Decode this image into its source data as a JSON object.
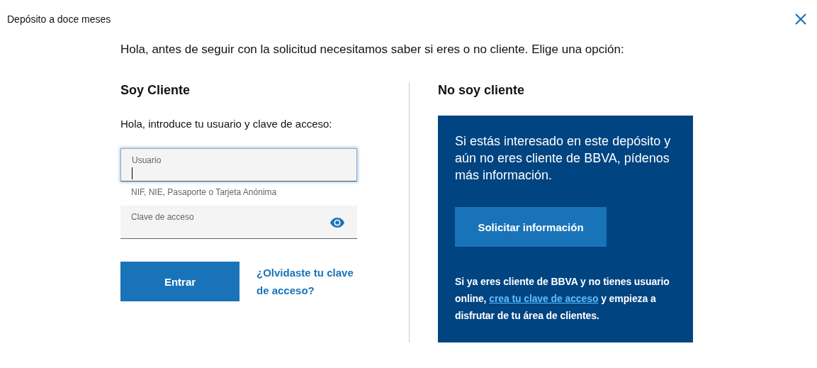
{
  "window": {
    "title": "Depósito a doce meses"
  },
  "intro": "Hola, antes de seguir con la solicitud necesitamos saber si eres o no cliente. Elige una opción:",
  "client": {
    "heading": "Soy Cliente",
    "prompt": "Hola, introduce tu usuario y clave de acceso:",
    "fields": [
      {
        "kind": "text",
        "placeholder": "Usuario",
        "focused": true,
        "hint": "NIF, NIE, Pasaporte o Tarjeta Anónima"
      },
      {
        "kind": "password",
        "placeholder": "Clave de acceso",
        "focused": false
      }
    ],
    "submit": "Entrar",
    "forgot_link": "¿Olvidaste tu clave de acceso?"
  },
  "non_client": {
    "heading": "No soy cliente",
    "message": "Si estás interesado en este depósito y aún no eres cliente de BBVA, pídenos más información.",
    "button": "Solicitar información",
    "note": {
      "before": "Si ya eres cliente de BBVA y no tienes usuario online, ",
      "link": "crea tu clave de acceso",
      "after": " y empieza a disfrutar de tu área de clientes."
    }
  }
}
